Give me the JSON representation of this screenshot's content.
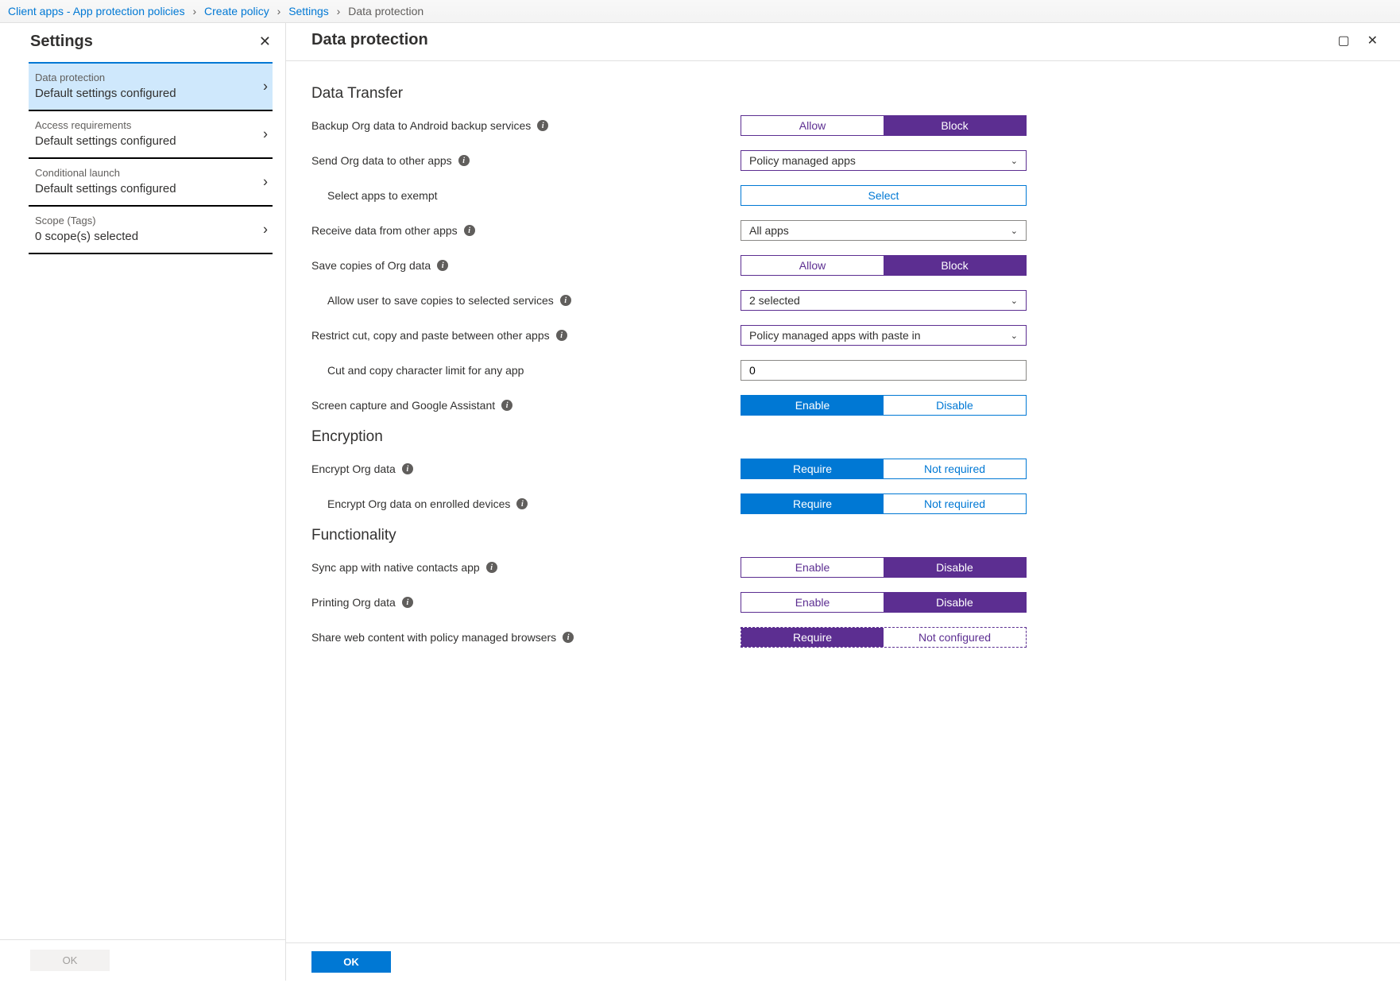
{
  "breadcrumb": {
    "items": [
      "Client apps - App protection policies",
      "Create policy",
      "Settings",
      "Data protection"
    ]
  },
  "sidebar": {
    "title": "Settings",
    "items": [
      {
        "title": "Data protection",
        "sub": "Default settings configured",
        "active": true
      },
      {
        "title": "Access requirements",
        "sub": "Default settings configured",
        "active": false
      },
      {
        "title": "Conditional launch",
        "sub": "Default settings configured",
        "active": false
      },
      {
        "title": "Scope (Tags)",
        "sub": "0 scope(s) selected",
        "active": false
      }
    ],
    "ok": "OK"
  },
  "content": {
    "title": "Data protection",
    "ok": "OK",
    "sections": {
      "data_transfer": {
        "title": "Data Transfer",
        "backup": {
          "label": "Backup Org data to Android backup services",
          "left": "Allow",
          "right": "Block",
          "selected": "right"
        },
        "send": {
          "label": "Send Org data to other apps",
          "value": "Policy managed apps"
        },
        "exempt": {
          "label": "Select apps to exempt",
          "button": "Select"
        },
        "receive": {
          "label": "Receive data from other apps",
          "value": "All apps"
        },
        "save": {
          "label": "Save copies of Org data",
          "left": "Allow",
          "right": "Block",
          "selected": "right"
        },
        "save_allow": {
          "label": "Allow user to save copies to selected services",
          "value": "2 selected"
        },
        "restrict": {
          "label": "Restrict cut, copy and paste between other apps",
          "value": "Policy managed apps with paste in"
        },
        "charlimit": {
          "label": "Cut and copy character limit for any app",
          "value": "0"
        },
        "screen": {
          "label": "Screen capture and Google Assistant",
          "left": "Enable",
          "right": "Disable",
          "selected": "left"
        }
      },
      "encryption": {
        "title": "Encryption",
        "encrypt": {
          "label": "Encrypt Org data",
          "left": "Require",
          "right": "Not required",
          "selected": "left"
        },
        "enrolled": {
          "label": "Encrypt Org data on enrolled devices",
          "left": "Require",
          "right": "Not required",
          "selected": "left"
        }
      },
      "functionality": {
        "title": "Functionality",
        "sync": {
          "label": "Sync app with native contacts app",
          "left": "Enable",
          "right": "Disable",
          "selected": "right"
        },
        "print": {
          "label": "Printing Org data",
          "left": "Enable",
          "right": "Disable",
          "selected": "right"
        },
        "share": {
          "label": "Share web content with policy managed browsers",
          "left": "Require",
          "right": "Not configured",
          "selected": "left"
        }
      }
    }
  }
}
